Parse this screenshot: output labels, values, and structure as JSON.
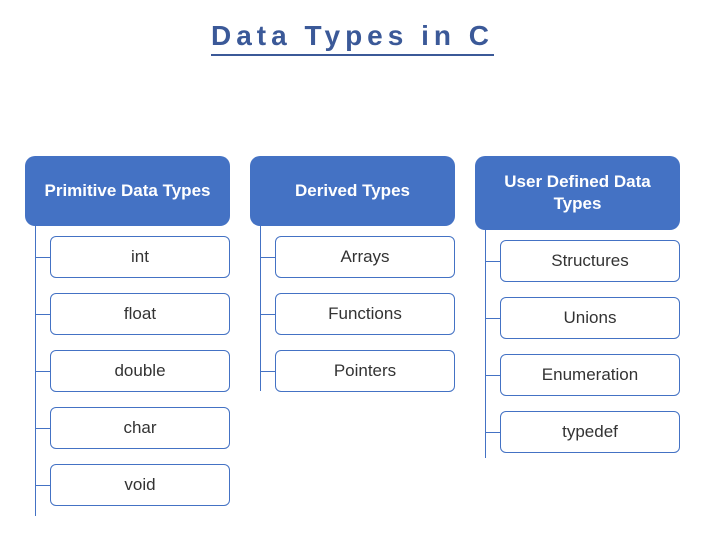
{
  "title": "Data Types in C",
  "categories": [
    {
      "name": "Primitive Data Types",
      "items": [
        "int",
        "float",
        "double",
        "char",
        "void"
      ]
    },
    {
      "name": "Derived Types",
      "items": [
        "Arrays",
        "Functions",
        "Pointers"
      ]
    },
    {
      "name": "User Defined Data Types",
      "items": [
        "Structures",
        "Unions",
        "Enumeration",
        "typedef"
      ]
    }
  ]
}
